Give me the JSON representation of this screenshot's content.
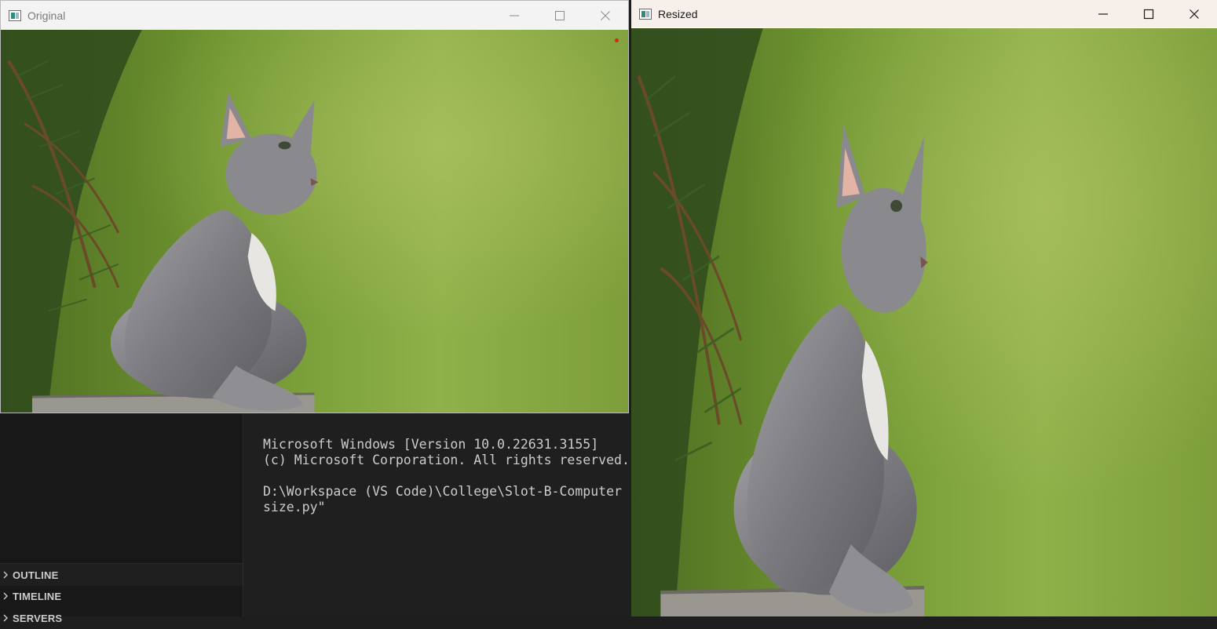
{
  "windows": {
    "original": {
      "title": "Original"
    },
    "resized": {
      "title": "Resized"
    }
  },
  "terminal": {
    "lines": [
      "Microsoft Windows [Version 10.0.22631.3155]",
      "(c) Microsoft Corporation. All rights reserved.",
      "",
      "D:\\Workspace (VS Code)\\College\\Slot-B-Computer",
      "size.py\""
    ]
  },
  "sidebar": {
    "sections": [
      "OUTLINE",
      "TIMELINE",
      "SERVERS"
    ]
  },
  "image": {
    "subject": "grey-kitten-on-rock",
    "colors": {
      "background": "#7fa23a",
      "fur": "#8a8a8e",
      "rock": "#9a9690",
      "branches": "#2f4a1c"
    }
  }
}
